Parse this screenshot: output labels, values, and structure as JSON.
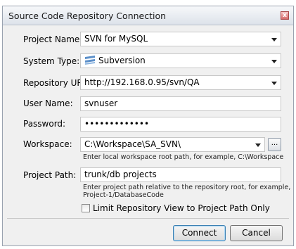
{
  "dialog": {
    "title": "Source Code Repository Connection",
    "close_glyph": "x"
  },
  "form": {
    "project_name": {
      "label": "Project Name:",
      "value": "SVN for MySQL"
    },
    "system_type": {
      "label": "System Type:",
      "value": "Subversion",
      "icon": "subversion-logo-icon"
    },
    "repository_url": {
      "label": "Repository URL:",
      "value": "http://192.168.0.95/svn/QA"
    },
    "user_name": {
      "label": "User Name:",
      "value": "svnuser"
    },
    "password": {
      "label": "Password:",
      "value": "•••••••••••••"
    },
    "workspace": {
      "label": "Workspace:",
      "value": "C:\\Workspace\\SA_SVN\\",
      "browse_label": "...",
      "hint": "Enter local workspace root path, for example, C:\\Workspace"
    },
    "project_path": {
      "label": "Project Path:",
      "value": "trunk/db projects",
      "hint_line1": "Enter project path relative to the repository root, for example,",
      "hint_line2": "Project-1/DatabaseCode"
    },
    "limit_view": {
      "label": "Limit Repository View to Project Path Only",
      "checked": false
    }
  },
  "buttons": {
    "connect": "Connect",
    "cancel": "Cancel"
  },
  "colors": {
    "subversion_blue": "#5b8fc9",
    "focus_border": "#3c7fb1"
  }
}
